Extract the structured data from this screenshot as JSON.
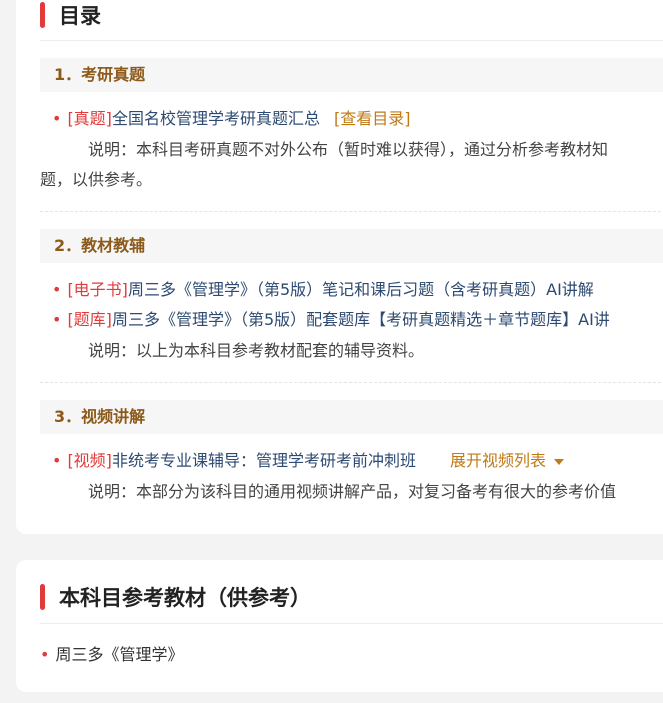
{
  "toc": {
    "title": "目录",
    "sections": [
      {
        "title": "1．考研真题",
        "items": [
          {
            "tag": "[真题]",
            "text": "全国名校管理学考研真题汇总",
            "action": "[查看目录]"
          }
        ],
        "note_line1": "说明：本科目考研真题不对外公布（暂时难以获得），通过分析参考教材知",
        "note_line2": "题，以供参考。"
      },
      {
        "title": "2．教材教辅",
        "items": [
          {
            "tag": "[电子书]",
            "text": "周三多《管理学》（第5版）笔记和课后习题（含考研真题）AI讲解"
          },
          {
            "tag": "[题库]",
            "text": "周三多《管理学》（第5版）配套题库【考研真题精选＋章节题库】AI讲"
          }
        ],
        "note": "说明：以上为本科目参考教材配套的辅导资料。"
      },
      {
        "title": "3．视频讲解",
        "items": [
          {
            "tag": "[视频]",
            "text": "非统考专业课辅导：管理学考研考前冲刺班",
            "action": "展开视频列表"
          }
        ],
        "note": "说明：本部分为该科目的通用视频讲解产品，对复习备考有很大的参考价值"
      }
    ]
  },
  "references": {
    "title": "本科目参考教材（供参考）",
    "items": [
      "周三多《管理学》"
    ]
  },
  "colors": {
    "accent": "#e03a3a",
    "section_title": "#8c5a1a",
    "link": "#2d4a72",
    "action": "#c07a18"
  }
}
